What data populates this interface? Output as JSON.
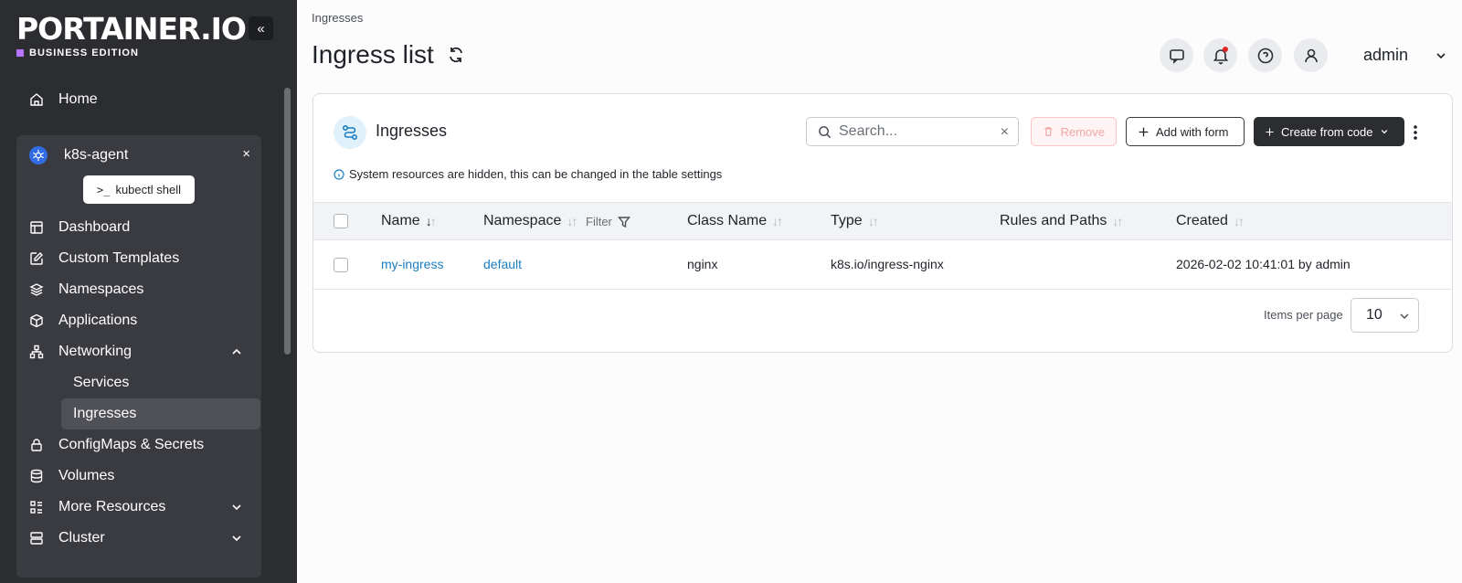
{
  "sidebar": {
    "logo_main": "PORTAINER.IO",
    "logo_edition": "BUSINESS EDITION",
    "collapse_label": "«",
    "home_label": "Home",
    "environment": {
      "name": "k8s-agent",
      "close_label": "×",
      "kubectl_prompt": ">_",
      "kubectl_label": "kubectl shell"
    },
    "items": [
      {
        "label": "Dashboard",
        "icon": "dashboard-icon"
      },
      {
        "label": "Custom Templates",
        "icon": "edit-icon"
      },
      {
        "label": "Namespaces",
        "icon": "layers-icon"
      },
      {
        "label": "Applications",
        "icon": "box-icon"
      },
      {
        "label": "Networking",
        "icon": "network-icon",
        "expanded": true
      },
      {
        "label": "ConfigMaps & Secrets",
        "icon": "lock-icon"
      },
      {
        "label": "Volumes",
        "icon": "database-icon"
      },
      {
        "label": "More Resources",
        "icon": "list-icon",
        "expanded": false
      },
      {
        "label": "Cluster",
        "icon": "server-icon",
        "expanded": false
      }
    ],
    "networking_children": [
      {
        "label": "Services",
        "active": false
      },
      {
        "label": "Ingresses",
        "active": true
      }
    ]
  },
  "header": {
    "breadcrumb": "Ingresses",
    "title": "Ingress list",
    "user": "admin"
  },
  "card": {
    "title": "Ingresses",
    "search_placeholder": "Search...",
    "search_clear": "×",
    "remove_label": "Remove",
    "add_label": "Add with form",
    "create_label": "Create from code",
    "info": "System resources are hidden, this can be changed in the table settings",
    "columns": {
      "name": "Name",
      "namespace": "Namespace",
      "filter": "Filter",
      "class_name": "Class Name",
      "type": "Type",
      "rules": "Rules and Paths",
      "created": "Created"
    },
    "rows": [
      {
        "name": "my-ingress",
        "namespace": "default",
        "class_name": "nginx",
        "type": "k8s.io/ingress-nginx",
        "rules": "",
        "created": "2026-02-02 10:41:01 by admin"
      }
    ],
    "items_per_page_label": "Items per page",
    "items_per_page_value": "10"
  },
  "colors": {
    "sidebar_bg": "#2c2d31",
    "env_bg": "#3a3b40",
    "accent_purple": "#b675ff",
    "link_blue": "#1a7fc1",
    "kubernetes_blue": "#326ce5",
    "notification_red": "#e02424"
  }
}
